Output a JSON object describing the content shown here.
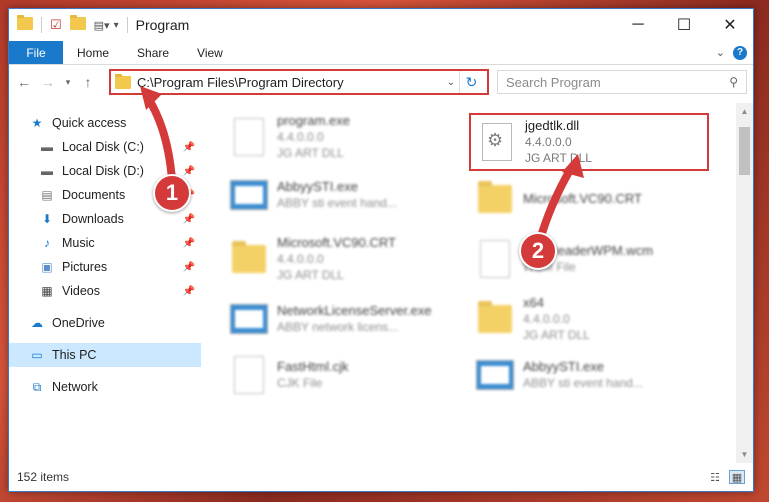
{
  "window": {
    "title": "Program",
    "controls": {
      "minimize": "─",
      "maximize": "☐",
      "close": "✕"
    }
  },
  "ribbon": {
    "file": "File",
    "tabs": [
      "Home",
      "Share",
      "View"
    ],
    "help": "?"
  },
  "nav": {
    "address": "C:\\Program Files\\Program Directory",
    "search_placeholder": "Search Program"
  },
  "sidebar": {
    "items": [
      {
        "label": "Quick access",
        "icon": "star-icon",
        "pinned": false
      },
      {
        "label": "Local Disk (C:)",
        "icon": "drive-icon",
        "pinned": true
      },
      {
        "label": "Local Disk (D:)",
        "icon": "drive-icon",
        "pinned": true
      },
      {
        "label": "Documents",
        "icon": "documents-icon",
        "pinned": true
      },
      {
        "label": "Downloads",
        "icon": "download-icon",
        "pinned": true
      },
      {
        "label": "Music",
        "icon": "music-icon",
        "pinned": true
      },
      {
        "label": "Pictures",
        "icon": "pictures-icon",
        "pinned": true
      },
      {
        "label": "Videos",
        "icon": "videos-icon",
        "pinned": true
      },
      {
        "label": "OneDrive",
        "icon": "cloud-icon",
        "pinned": false
      },
      {
        "label": "This PC",
        "icon": "pc-icon",
        "pinned": false
      },
      {
        "label": "Network",
        "icon": "network-icon",
        "pinned": false
      }
    ]
  },
  "files": [
    {
      "name": "program.exe",
      "line2": "4.4.0.0.0",
      "line3": "JG ART DLL"
    },
    {
      "name": "jgedtlk.dll",
      "line2": "4.4.0.0.0",
      "line3": "JG ART DLL"
    },
    {
      "name": "AbbyySTI.exe",
      "line2": "ABBY sti event hand...",
      "line3": ""
    },
    {
      "name": "Microsoft.VC90.CRT",
      "line2": "",
      "line3": ""
    },
    {
      "name": "Microsoft.VC90.CRT",
      "line2": "4.4.0.0.0",
      "line3": "JG ART DLL"
    },
    {
      "name": "FineReaderWPM.wcm",
      "line2": "WCM File",
      "line3": ""
    },
    {
      "name": "NetworkLicenseServer.exe",
      "line2": "ABBY network licens...",
      "line3": ""
    },
    {
      "name": "x64",
      "line2": "4.4.0.0.0",
      "line3": "JG ART DLL"
    },
    {
      "name": "FastHtml.cjk",
      "line2": "CJK File",
      "line3": ""
    },
    {
      "name": "AbbyySTI.exe",
      "line2": "ABBY sti event hand...",
      "line3": ""
    }
  ],
  "status": {
    "count": "152 items"
  },
  "annotations": {
    "one": "1",
    "two": "2"
  },
  "colors": {
    "accent": "#1979ca",
    "highlight": "#d53a3a",
    "selected": "#cce8ff"
  }
}
